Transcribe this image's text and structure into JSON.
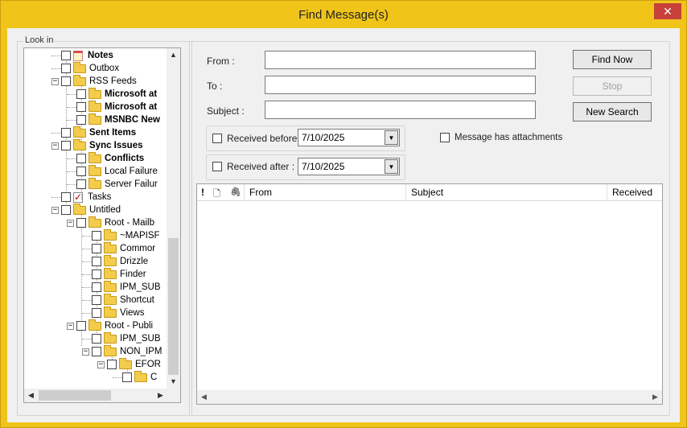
{
  "window": {
    "title": "Find Message(s)",
    "close_glyph": "✕"
  },
  "lookin": {
    "legend": "Look in",
    "tree": [
      {
        "label": "Notes",
        "icon": "notes-icon",
        "bold": true
      },
      {
        "label": "Outbox",
        "icon": "folder-icon",
        "bold": false
      },
      {
        "label": "RSS Feeds",
        "icon": "folder-icon",
        "bold": false
      },
      {
        "label": "Microsoft at",
        "icon": "folder-icon",
        "bold": true
      },
      {
        "label": "Microsoft at",
        "icon": "folder-icon",
        "bold": true
      },
      {
        "label": "MSNBC New",
        "icon": "folder-icon",
        "bold": true
      },
      {
        "label": "Sent Items",
        "icon": "folder-icon",
        "bold": true
      },
      {
        "label": "Sync Issues",
        "icon": "folder-icon",
        "bold": true
      },
      {
        "label": "Conflicts",
        "icon": "folder-icon",
        "bold": true
      },
      {
        "label": "Local Failure",
        "icon": "folder-icon",
        "bold": false
      },
      {
        "label": "Server Failur",
        "icon": "folder-icon",
        "bold": false
      },
      {
        "label": "Tasks",
        "icon": "tasks-icon",
        "bold": false
      },
      {
        "label": "Untitled",
        "icon": "folder-icon",
        "bold": false
      },
      {
        "label": "Root - Mailb",
        "icon": "folder-icon",
        "bold": false
      },
      {
        "label": "~MAPISF",
        "icon": "folder-icon",
        "bold": false
      },
      {
        "label": "Commor",
        "icon": "folder-icon",
        "bold": false
      },
      {
        "label": "Drizzle",
        "icon": "folder-icon",
        "bold": false
      },
      {
        "label": "Finder",
        "icon": "folder-icon",
        "bold": false
      },
      {
        "label": "IPM_SUB",
        "icon": "folder-icon",
        "bold": false
      },
      {
        "label": "Shortcut",
        "icon": "folder-icon",
        "bold": false
      },
      {
        "label": "Views",
        "icon": "folder-icon",
        "bold": false
      },
      {
        "label": "Root - Publi",
        "icon": "folder-icon",
        "bold": false
      },
      {
        "label": "IPM_SUB",
        "icon": "folder-icon",
        "bold": false
      },
      {
        "label": "NON_IPM",
        "icon": "folder-icon",
        "bold": false
      },
      {
        "label": "EFOR",
        "icon": "folder-icon",
        "bold": false
      },
      {
        "label": "C",
        "icon": "folder-icon",
        "bold": false
      }
    ]
  },
  "form": {
    "from_label": "From :",
    "from_value": "",
    "to_label": "To :",
    "to_value": "",
    "subject_label": "Subject :",
    "subject_value": "",
    "received_before_label": "Received before :",
    "received_before_value": "7/10/2025",
    "received_after_label": "Received after :",
    "received_after_value": "7/10/2025",
    "attachments_label": "Message has attachments"
  },
  "buttons": {
    "find_now": "Find Now",
    "stop": "Stop",
    "new_search": "New Search"
  },
  "results": {
    "columns": [
      {
        "label": "!"
      },
      {
        "label": "🗋"
      },
      {
        "label": "🖇"
      },
      {
        "label": "From"
      },
      {
        "label": "Subject"
      },
      {
        "label": "Received"
      }
    ]
  },
  "colors": {
    "window_frame": "#f0c419",
    "close_button": "#c7403a"
  }
}
